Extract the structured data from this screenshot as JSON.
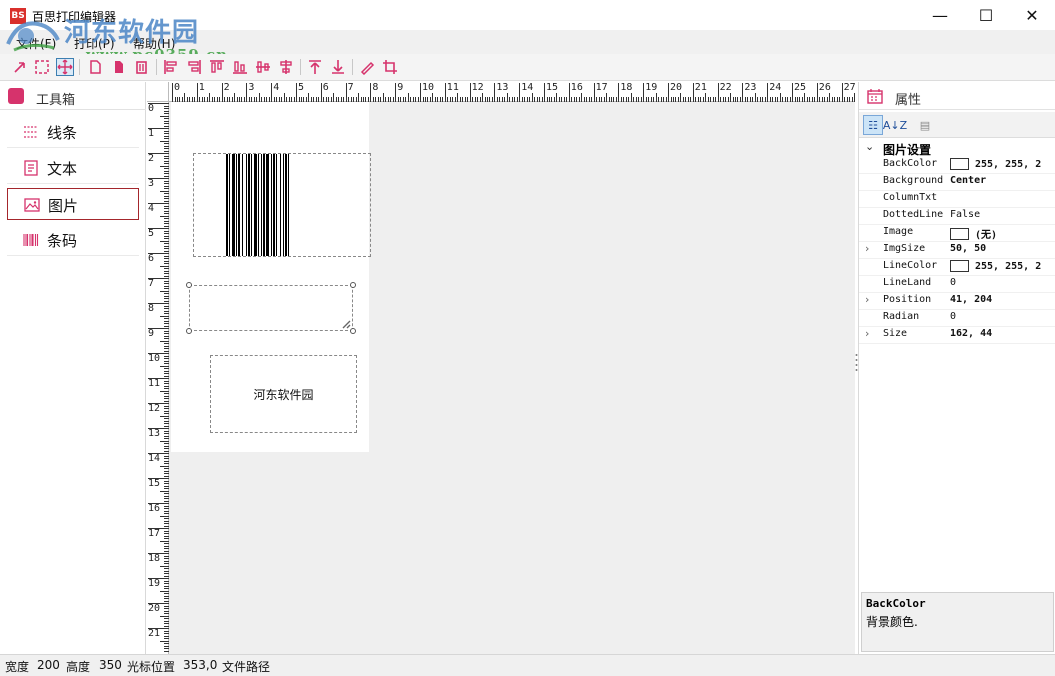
{
  "window": {
    "icon_text": "BS",
    "title": "百思打印编辑器",
    "controls": {
      "minimize": "—",
      "maximize": "☐",
      "close": "✕"
    }
  },
  "watermark": {
    "site_name": "河东软件园",
    "url": "www.pc0359.cn"
  },
  "menu": {
    "items": [
      "文件(F)",
      "打印(P)",
      "帮助(H)"
    ]
  },
  "toolbar": {
    "icons": [
      "select-arrow-icon",
      "select-rect-icon",
      "move-icon",
      "page-icon",
      "copy-icon",
      "delete-icon",
      "align-left-icon",
      "align-right-icon",
      "align-top-icon",
      "align-bottom-icon",
      "center-horizontal-icon",
      "center-vertical-icon",
      "bring-front-icon",
      "send-back-icon",
      "pen-icon",
      "crop-icon"
    ]
  },
  "toolbox": {
    "title": "工具箱",
    "items": [
      {
        "label": "线条",
        "icon": "line-tool-icon"
      },
      {
        "label": "文本",
        "icon": "text-tool-icon"
      },
      {
        "label": "图片",
        "icon": "image-tool-icon"
      },
      {
        "label": "条码",
        "icon": "barcode-tool-icon"
      }
    ],
    "selected_index": 2
  },
  "rulers": {
    "top": [
      "0",
      "1",
      "2",
      "3",
      "4",
      "5",
      "6",
      "7",
      "8",
      "9",
      "10",
      "11",
      "12",
      "13",
      "14",
      "15",
      "16",
      "17",
      "18",
      "19",
      "20",
      "21",
      "22",
      "23",
      "24",
      "25",
      "26",
      "27"
    ],
    "left": [
      "0",
      "1",
      "2",
      "3",
      "4",
      "5",
      "6",
      "7",
      "8",
      "9",
      "10",
      "11",
      "12",
      "13",
      "14",
      "15",
      "16",
      "17",
      "18",
      "19",
      "20",
      "21"
    ]
  },
  "canvas": {
    "text_element": "河东软件园"
  },
  "properties": {
    "title": "属性",
    "toolbar": {
      "categorized": "☷",
      "alphabetical": "A↓Z",
      "pages": "▤"
    },
    "category": "图片设置",
    "rows": [
      {
        "name": "BackColor",
        "value": "255, 255, 2",
        "swatch": "#ffffff",
        "expandable": false,
        "bold": true
      },
      {
        "name": "Background",
        "value": "Center",
        "swatch": null,
        "expandable": false,
        "bold": true
      },
      {
        "name": "ColumnTxt",
        "value": "",
        "swatch": null,
        "expandable": false,
        "bold": false
      },
      {
        "name": "DottedLine",
        "value": "False",
        "swatch": null,
        "expandable": false,
        "bold": false
      },
      {
        "name": "Image",
        "value": "(无)",
        "swatch": "#ffffff",
        "expandable": false,
        "bold": true
      },
      {
        "name": "ImgSize",
        "value": "50, 50",
        "swatch": null,
        "expandable": true,
        "bold": true
      },
      {
        "name": "LineColor",
        "value": "255, 255, 2",
        "swatch": "#ffffff",
        "expandable": false,
        "bold": true
      },
      {
        "name": "LineLand",
        "value": "0",
        "swatch": null,
        "expandable": false,
        "bold": false
      },
      {
        "name": "Position",
        "value": "41, 204",
        "swatch": null,
        "expandable": true,
        "bold": true
      },
      {
        "name": "Radian",
        "value": "0",
        "swatch": null,
        "expandable": false,
        "bold": false
      },
      {
        "name": "Size",
        "value": "162, 44",
        "swatch": null,
        "expandable": true,
        "bold": true
      }
    ],
    "description": {
      "name": "BackColor",
      "text": "背景颜色."
    }
  },
  "status": {
    "width_label": "宽度",
    "width_value": "200",
    "height_label": "高度",
    "height_value": "350",
    "cursor_label": "光标位置",
    "cursor_value": "353,0",
    "path_label": "文件路径"
  },
  "colors": {
    "accent": "#d6336c",
    "selected_border": "#a4262c",
    "canvas_bg": "#efefef"
  }
}
